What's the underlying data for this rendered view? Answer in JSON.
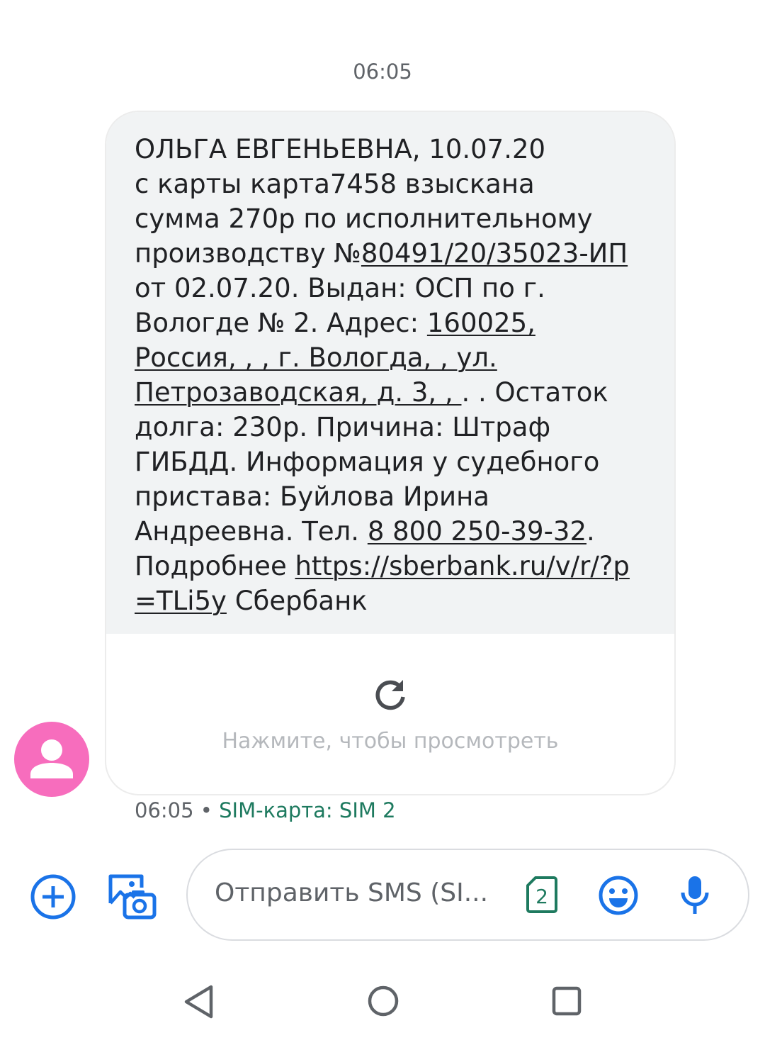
{
  "date_separator": "06:05",
  "message": {
    "lines": [
      [
        {
          "t": "ОЛЬГА ЕВГЕНЬЕВНА, 10.07.20"
        }
      ],
      [
        {
          "t": "с карты карта7458 взыскана"
        }
      ],
      [
        {
          "t": "сумма 270р по исполнительному"
        }
      ],
      [
        {
          "t": "производству №"
        },
        {
          "t": "80491/20/35023-ИП",
          "link": true
        }
      ],
      [
        {
          "t": "от 02.07.20. Выдан: ОСП по г."
        }
      ],
      [
        {
          "t": "Вологде № 2.  Адрес: "
        },
        {
          "t": "160025,",
          "link": true
        }
      ],
      [
        {
          "t": "Россия, , , г. Вологда, , ул.",
          "link": true
        }
      ],
      [
        {
          "t": "Петрозаводская, д. 3, , ",
          "link": true
        },
        {
          "t": ". . Остаток"
        }
      ],
      [
        {
          "t": "долга: 230р. Причина: Штраф"
        }
      ],
      [
        {
          "t": "ГИБДД. Информация у судебного"
        }
      ],
      [
        {
          "t": "пристава: Буйлова Ирина"
        }
      ],
      [
        {
          "t": "Андреевна. Тел. "
        },
        {
          "t": "8 800 250-39-32",
          "link": true
        },
        {
          "t": "."
        }
      ],
      [
        {
          "t": "Подробнее "
        },
        {
          "t": "https://sberbank.ru/v/r/?p",
          "link": true
        }
      ],
      [
        {
          "t": "=TLi5y",
          "link": true
        },
        {
          "t": " Сбербанк"
        }
      ]
    ],
    "preview_label": "Нажмите, чтобы просмотреть",
    "time": "06:05",
    "separator": " • ",
    "sim_label": "SIM-карта: SIM 2"
  },
  "compose": {
    "placeholder": "Отправить SMS (SI...",
    "sim_number": "2"
  },
  "colors": {
    "avatar": "#f76dbd",
    "accent": "#1a73e8",
    "sim": "#1e7a5f",
    "bubble": "#f1f3f4"
  },
  "icons": [
    "avatar-person-icon",
    "reload-icon",
    "add-icon",
    "gallery-camera-icon",
    "sim-card-icon",
    "emoji-icon",
    "mic-icon",
    "nav-back-icon",
    "nav-home-icon",
    "nav-recent-icon"
  ]
}
